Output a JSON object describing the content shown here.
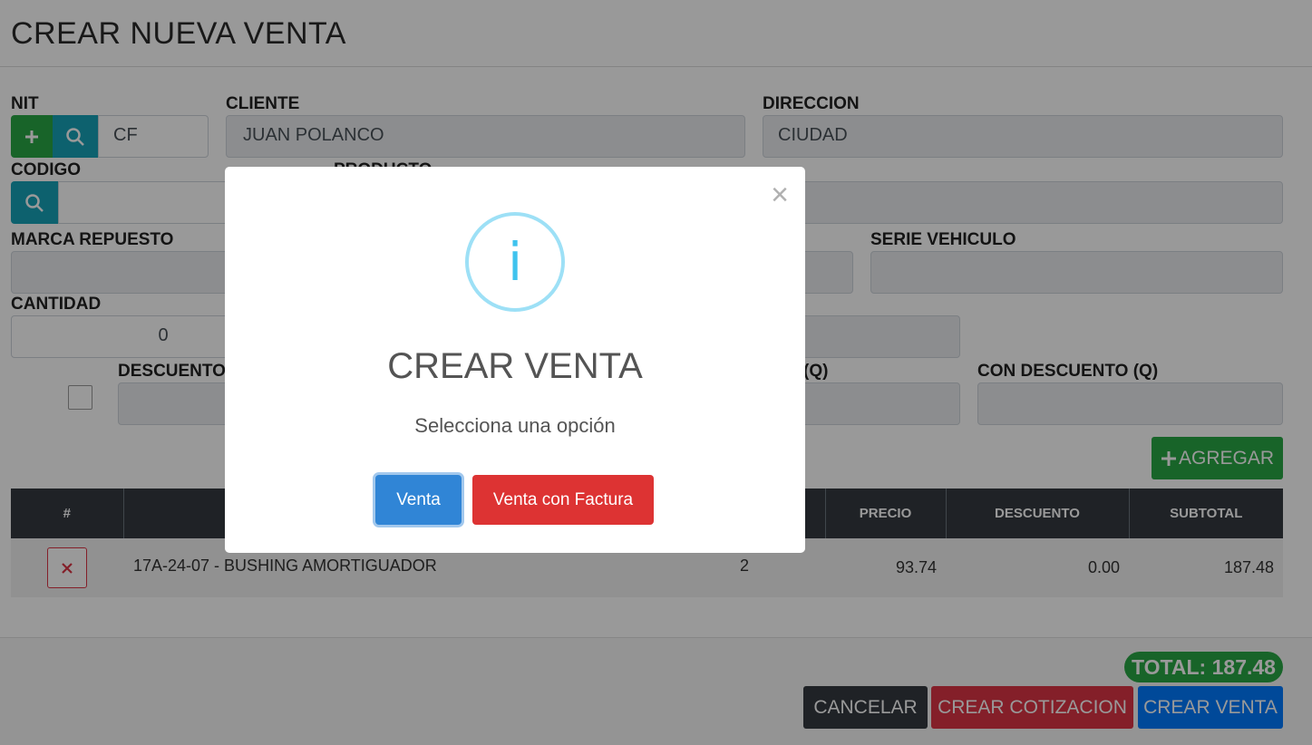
{
  "page": {
    "title": "CREAR NUEVA VENTA"
  },
  "form": {
    "nit_label": "NIT",
    "nit_value": "CF",
    "cliente_label": "CLIENTE",
    "cliente_value": "JUAN POLANCO",
    "direccion_label": "DIRECCION",
    "direccion_value": "CIUDAD",
    "codigo_label": "CODIGO",
    "producto_label": "PRODUCTO",
    "marca_label": "MARCA REPUESTO",
    "serie_label": "SERIE VEHICULO",
    "cantidad_label": "CANTIDAD",
    "cantidad_value": "0",
    "descuento_label": "DESCUENTO",
    "q_label_partial": "(Q)",
    "con_descuento_label": "CON DESCUENTO (Q)",
    "agregar_label": "AGREGAR"
  },
  "table": {
    "headers": [
      "#",
      "",
      "PRECIO",
      "DESCUENTO",
      "SUBTOTAL"
    ],
    "rows": [
      {
        "producto": "17A-24-07 - BUSHING AMORTIGUADOR",
        "cantidad": "2",
        "precio": "93.74",
        "descuento": "0.00",
        "subtotal": "187.48"
      }
    ]
  },
  "footer": {
    "total": "TOTAL: 187.48",
    "cancelar": "CANCELAR",
    "crear_cotizacion": "CREAR COTIZACION",
    "crear_venta": "CREAR VENTA"
  },
  "modal": {
    "icon_char": "i",
    "title": "CREAR VENTA",
    "text": "Selecciona una opción",
    "btn_venta": "Venta",
    "btn_factura": "Venta con Factura",
    "close_char": "×"
  },
  "colors": {
    "green": "#28a745",
    "teal": "#17a2b8",
    "red": "#dc3545",
    "blue": "#007bff",
    "dark": "#343a40",
    "modal_blue": "#3085d6",
    "modal_red": "#dd3333",
    "info_icon": "#3fc3ee"
  }
}
